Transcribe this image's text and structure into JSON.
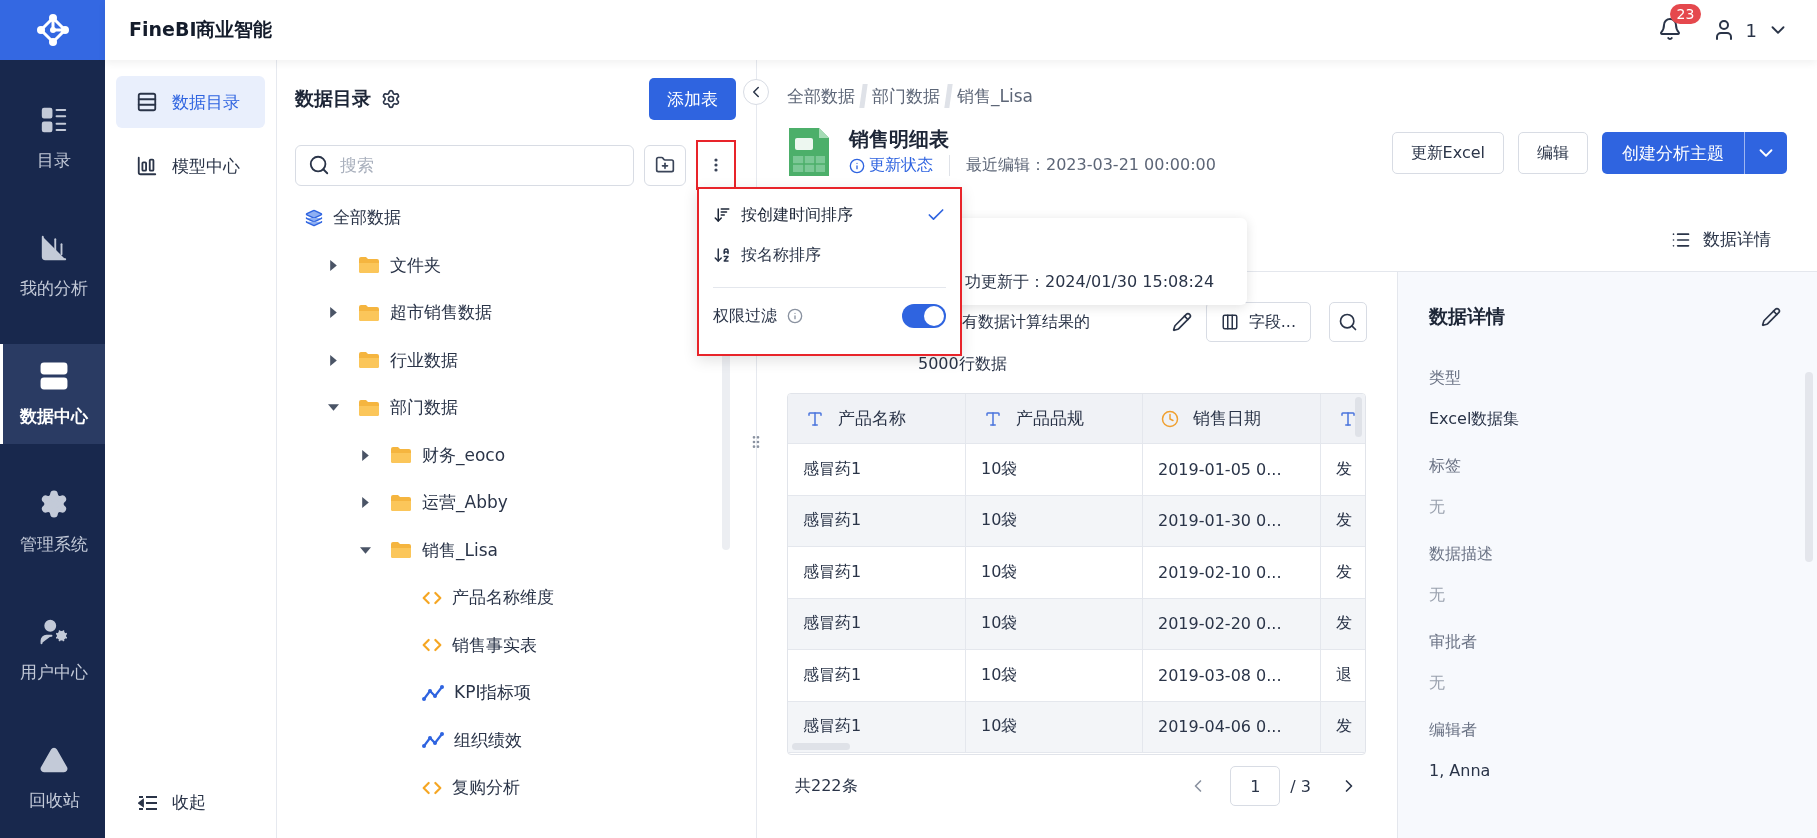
{
  "app": {
    "title": "FineBI商业智能",
    "notification_count": "23",
    "user": "1"
  },
  "nav": [
    {
      "label": "目录",
      "selected": false
    },
    {
      "label": "我的分析",
      "selected": false
    },
    {
      "label": "数据中心",
      "selected": true
    },
    {
      "label": "管理系统",
      "selected": false
    },
    {
      "label": "用户中心",
      "selected": false
    },
    {
      "label": "回收站",
      "selected": false
    }
  ],
  "subnav": {
    "items": [
      {
        "label": "数据目录",
        "selected": true
      },
      {
        "label": "模型中心",
        "selected": false
      }
    ],
    "collapse": "收起"
  },
  "catalog": {
    "title": "数据目录",
    "add_button": "添加表",
    "search": {
      "placeholder": "搜索"
    },
    "tree": [
      {
        "label": "全部数据",
        "kind": "root",
        "children": [
          {
            "label": "文件夹",
            "kind": "folder",
            "expanded": false
          },
          {
            "label": "超市销售数据",
            "kind": "folder",
            "expanded": false
          },
          {
            "label": "行业数据",
            "kind": "folder",
            "expanded": false
          },
          {
            "label": "部门数据",
            "kind": "folder",
            "expanded": true,
            "children": [
              {
                "label": "财务_eoco",
                "kind": "folder",
                "expanded": false
              },
              {
                "label": "运营_Abby",
                "kind": "folder",
                "expanded": false
              },
              {
                "label": "销售_Lisa",
                "kind": "folder",
                "expanded": true,
                "children": [
                  {
                    "label": "产品名称维度",
                    "kind": "sql"
                  },
                  {
                    "label": "销售事实表",
                    "kind": "sql"
                  },
                  {
                    "label": "KPI指标项",
                    "kind": "metric"
                  },
                  {
                    "label": "组织绩效",
                    "kind": "metric"
                  },
                  {
                    "label": "复购分析",
                    "kind": "sql"
                  }
                ]
              }
            ]
          }
        ]
      }
    ]
  },
  "sort_menu": {
    "items": [
      {
        "label": "按创建时间排序",
        "selected": true
      },
      {
        "label": "按名称排序",
        "selected": false
      }
    ],
    "filter": {
      "label": "权限过滤",
      "on": true
    }
  },
  "breadcrumb": [
    "全部数据",
    "部门数据",
    "销售_Lisa"
  ],
  "dataset": {
    "title": "销售明细表",
    "status_link": "更新状态",
    "last_edit": "最近编辑：2023-03-21 00:00:00",
    "buttons": [
      "更新Excel",
      "编辑"
    ],
    "primary_button": "创建分析主题",
    "tab": "数据详情"
  },
  "tooltip": {
    "text": "功更新于：2024/01/30 15:08:24"
  },
  "preview": {
    "summary": [
      "有数据计算结果的",
      "5000行数据"
    ],
    "fields_button": "字段...",
    "columns": [
      {
        "label": "产品名称",
        "kind": "text"
      },
      {
        "label": "产品品规",
        "kind": "text"
      },
      {
        "label": "销售日期",
        "kind": "date"
      },
      {
        "kind": "text"
      }
    ],
    "rows": [
      [
        "感冒药1",
        "10袋",
        "2019-01-05 0...",
        "发"
      ],
      [
        "感冒药1",
        "10袋",
        "2019-01-30 0...",
        "发"
      ],
      [
        "感冒药1",
        "10袋",
        "2019-02-10 0...",
        "发"
      ],
      [
        "感冒药1",
        "10袋",
        "2019-02-20 0...",
        "发"
      ],
      [
        "感冒药1",
        "10袋",
        "2019-03-08 0...",
        "退"
      ],
      [
        "感冒药1",
        "10袋",
        "2019-04-06 0...",
        "发"
      ]
    ],
    "total": "共222条",
    "page": "1",
    "pages": "/ 3"
  },
  "details": {
    "title": "数据详情",
    "fields": [
      {
        "label": "类型",
        "value": "Excel数据集",
        "empty": false
      },
      {
        "label": "标签",
        "value": "无",
        "empty": true
      },
      {
        "label": "数据描述",
        "value": "无",
        "empty": true
      },
      {
        "label": "审批者",
        "value": "无",
        "empty": true
      },
      {
        "label": "编辑者",
        "value": "1, Anna",
        "empty": false
      }
    ]
  }
}
